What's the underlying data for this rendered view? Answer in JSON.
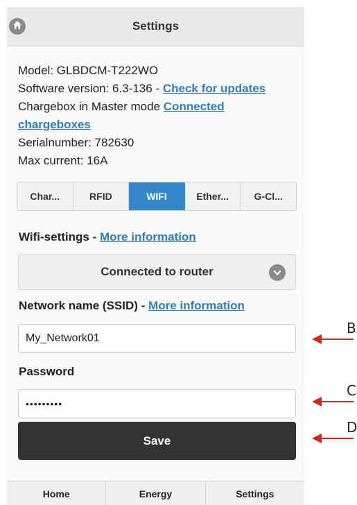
{
  "header": {
    "title": "Settings",
    "home_icon": "home-icon"
  },
  "info": {
    "model": "Model: GLBDCM-T222WO",
    "software_prefix": "Software version: 6.3-136 - ",
    "check_updates_link": "Check for updates",
    "mode_prefix": "Chargebox in Master mode ",
    "connected_link": "Connected chargeboxes",
    "serial": "Serialnumber: 782630",
    "max_current": "Max current: 16A"
  },
  "tabs": [
    {
      "label": "Char...",
      "active": false
    },
    {
      "label": "RFID",
      "active": false
    },
    {
      "label": "WIFI",
      "active": true
    },
    {
      "label": "Ether...",
      "active": false
    },
    {
      "label": "G-Cl...",
      "active": false
    }
  ],
  "wifi": {
    "label": "Wifi-settings - ",
    "more_info": "More information",
    "mode_selected": "Connected to router",
    "ssid_label": "Network name (SSID) - ",
    "ssid_more_info": "More information",
    "ssid_value": "My_Network01",
    "password_label": "Password",
    "password_value": "•••••••••",
    "save_label": "Save"
  },
  "navbar": [
    {
      "label": "Home"
    },
    {
      "label": "Energy"
    },
    {
      "label": "Settings"
    }
  ],
  "annotations": [
    {
      "label": "B"
    },
    {
      "label": "C"
    },
    {
      "label": "D"
    }
  ],
  "colors": {
    "accent": "#3388cc",
    "link": "#2d7fc2",
    "button_dark": "#333333",
    "annotation_arrow": "#d9251d"
  }
}
